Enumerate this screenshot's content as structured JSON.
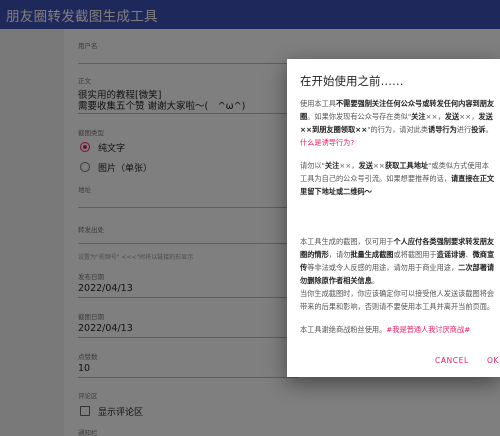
{
  "appbar": {
    "title": "朋友圈转发截图生成工具"
  },
  "form": {
    "username_label": "用户名",
    "text_label": "正文",
    "text_line1": "很实用的教程[微笑]",
    "text_line2": "需要收集五个赞 谢谢大家啦～(　^ω^)",
    "screenshot_type_label": "截图类型",
    "options": [
      "纯文字",
      "图片（单张）"
    ],
    "location_label": "地址",
    "forward_label": "转发出处",
    "forward_hint": "设置为\"视频号\" <<<\"时将以链接的形显示",
    "publish_date_label": "发布日期",
    "publish_date": "2022/04/13",
    "screenshot_date_label": "截图日期",
    "screenshot_date": "2022/04/13",
    "likes_label": "点赞数",
    "likes": "10",
    "comment_area_label": "评论区",
    "show_comments": "显示评论区",
    "notice_label": "通知栏"
  },
  "dialog": {
    "title": "在开始使用之前……",
    "p1_a": "使用本工具",
    "p1_b": "不需要强制关注任何公众号或转发任何内容到朋友圈",
    "p1_c": "。如果你发现有公众号存在类似\"",
    "p1_d": "关注",
    "p1_e": "××，",
    "p1_f": "发送",
    "p1_g": "××，",
    "p1_h": "发送××到朋友圈领取××",
    "p1_i": "\"的行为，请对此类",
    "p1_j": "诱导行为",
    "p1_k": "进行",
    "p1_l": "投诉",
    "p1_m": "。",
    "p1_link": "什么是诱导行为?",
    "p2_a": "请勿以\"",
    "p2_b": "关注",
    "p2_c": "××，",
    "p2_d": "发送",
    "p2_e": "××",
    "p2_f": "获取工具地址",
    "p2_g": "\"或类似方式使用本工具为自己的公众号引流。如果想要推荐的话，",
    "p2_h": "请直接在正文里留下地址或二维码～",
    "p3_a": "本工具生成的截图，仅可用于",
    "p3_b": "个人应付各类强制要求转发朋友圈的情形",
    "p3_c": "，请勿",
    "p3_d": "批量生成截图",
    "p3_e": "或将截图用于",
    "p3_f": "造谣诽谤",
    "p3_g": "、",
    "p3_h": "微商宣传",
    "p3_i": "等非法或令人反感的用途，请勿用于商业用途，",
    "p3_j": "二次部署请勿删除原作者相关信息",
    "p3_k": "。",
    "p4": "当你生成截图时，你应该确定你可以接受他人发送该截图将会带来的后果和影响，否则请不要使用本工具并离开当前页面。",
    "p5_a": "本工具谢绝商战粉丝使用。",
    "p5_b": "#我是普通人我讨厌商战#",
    "cancel": "CANCEL",
    "ok": "OK"
  }
}
